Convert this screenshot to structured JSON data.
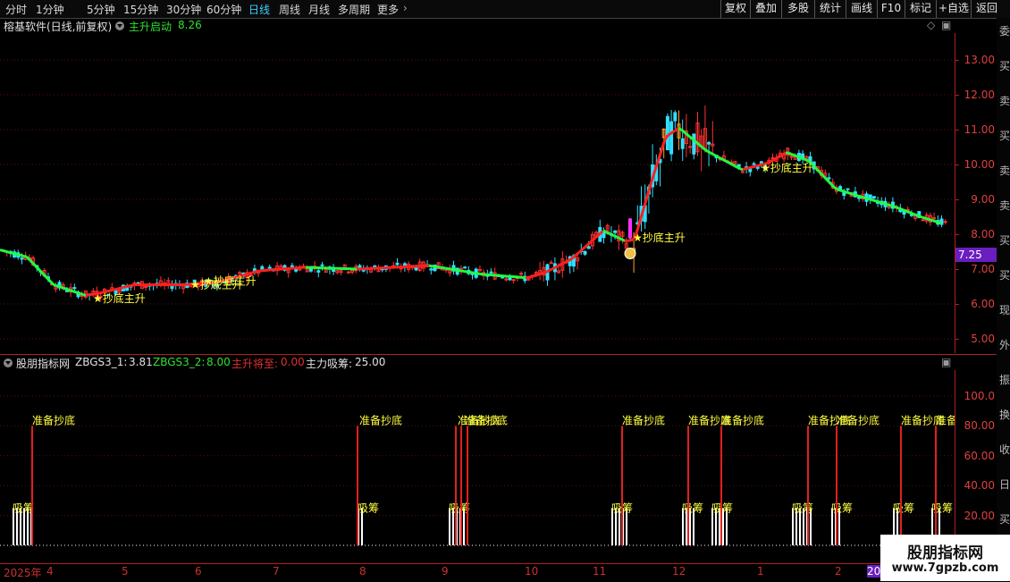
{
  "toolbar": {
    "periods": [
      "分时",
      "1分钟",
      "5分钟",
      "15分钟",
      "30分钟",
      "60分钟",
      "日线",
      "周线",
      "月线",
      "多周期",
      "更多"
    ],
    "active_period": "日线",
    "buttons": [
      "复权",
      "叠加",
      "多股",
      "统计",
      "画线",
      "F10",
      "标记",
      "+自选",
      "返回"
    ]
  },
  "main_chart": {
    "title": "榕基软件(日线,前复权)",
    "indicator_name": "主升启动",
    "indicator_value": "8.26",
    "y_ticks": [
      "13.00",
      "12.00",
      "11.00",
      "10.00",
      "9.00",
      "8.00",
      "7.00",
      "6.00",
      "5.00"
    ],
    "current_price": "7.25",
    "signal_label": "★抄底主升"
  },
  "sub_chart": {
    "title": "股朋指标网",
    "items": [
      {
        "label": "ZBGS3_1:",
        "value": "3.81",
        "color": "#e0e0e0"
      },
      {
        "label": "ZBGS3_2:",
        "value": "8.00",
        "color": "#30e030"
      },
      {
        "label": "主升将至:",
        "value": "0.00",
        "color": "#e03030"
      },
      {
        "label": "主力吸筹:",
        "value": "25.00",
        "color": "#e0e0e0"
      }
    ],
    "y_ticks": [
      "100.0",
      "80.00",
      "60.00",
      "40.00",
      "20.00"
    ],
    "label_prepare": "准备抄底",
    "label_absorb": "吸筹"
  },
  "date_axis": [
    "2025年",
    "4",
    "5",
    "6",
    "7",
    "8",
    "9",
    "10",
    "11",
    "12",
    "1",
    "2",
    "20"
  ],
  "right_strip_chars": [
    "委",
    "买",
    "卖",
    "买",
    "卖",
    "卖",
    "买",
    "买",
    "现",
    "外",
    "振",
    "换",
    "收",
    "日",
    "买"
  ],
  "watermark": {
    "title": "股朋指标网",
    "url": "www.7gpzb.com"
  },
  "colors": {
    "up": "#ff3030",
    "down": "#30e0ff",
    "up_line": "#ff2020",
    "down_line": "#20ff40",
    "label": "#ffff40",
    "accent": "#6a1ebf"
  }
}
